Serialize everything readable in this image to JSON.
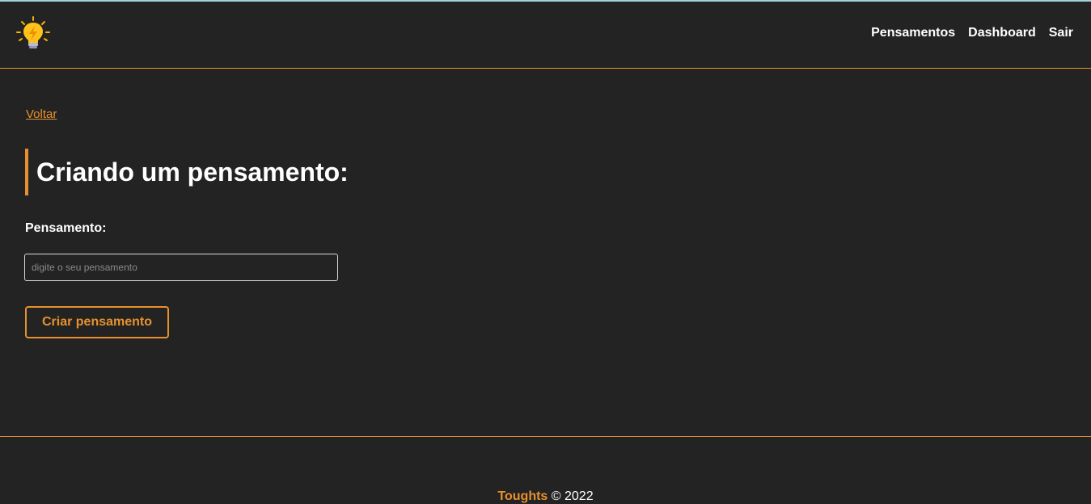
{
  "colors": {
    "background": "#232323",
    "accent": "#e8912c",
    "text": "#ffffff"
  },
  "header": {
    "logo_icon": "lightbulb-icon",
    "nav": [
      {
        "label": "Pensamentos"
      },
      {
        "label": "Dashboard"
      },
      {
        "label": "Sair"
      }
    ]
  },
  "main": {
    "back_label": "Voltar",
    "title": "Criando um pensamento:",
    "form": {
      "label": "Pensamento:",
      "placeholder": "digite o seu pensamento",
      "value": "",
      "submit_label": "Criar pensamento"
    }
  },
  "footer": {
    "brand": "Toughts",
    "copyright": "© 2022"
  }
}
